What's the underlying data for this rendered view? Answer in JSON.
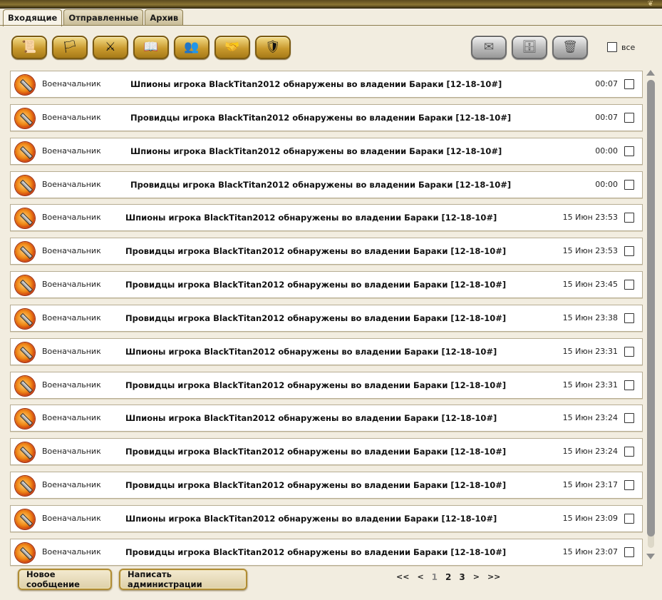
{
  "tabs": [
    {
      "label": "Входящие",
      "active": true
    },
    {
      "label": "Отправленные",
      "active": false
    },
    {
      "label": "Архив",
      "active": false
    }
  ],
  "toolbar": {
    "left_icons": [
      "scroll-letter-icon",
      "flag-icon",
      "sword-shield-icon",
      "book-icon",
      "people-icon",
      "handshake-icon",
      "warrior-icon"
    ],
    "right_icons": [
      "envelope-icon",
      "safe-icon",
      "trash-icon"
    ],
    "select_all_label": "все"
  },
  "messages": [
    {
      "sender": "Военачальник",
      "subject": "Шпионы игрока BlackTitan2012 обнаружены во владении Бараки [12-18-10#]",
      "time": "00:07"
    },
    {
      "sender": "Военачальник",
      "subject": "Провидцы игрока BlackTitan2012 обнаружены во владении Бараки [12-18-10#]",
      "time": "00:07"
    },
    {
      "sender": "Военачальник",
      "subject": "Шпионы игрока BlackTitan2012 обнаружены во владении Бараки [12-18-10#]",
      "time": "00:00"
    },
    {
      "sender": "Военачальник",
      "subject": "Провидцы игрока BlackTitan2012 обнаружены во владении Бараки [12-18-10#]",
      "time": "00:00"
    },
    {
      "sender": "Военачальник",
      "subject": "Шпионы игрока BlackTitan2012 обнаружены во владении Бараки [12-18-10#]",
      "time": "15 Июн 23:53"
    },
    {
      "sender": "Военачальник",
      "subject": "Провидцы игрока BlackTitan2012 обнаружены во владении Бараки [12-18-10#]",
      "time": "15 Июн 23:53"
    },
    {
      "sender": "Военачальник",
      "subject": "Провидцы игрока BlackTitan2012 обнаружены во владении Бараки [12-18-10#]",
      "time": "15 Июн 23:45"
    },
    {
      "sender": "Военачальник",
      "subject": "Провидцы игрока BlackTitan2012 обнаружены во владении Бараки [12-18-10#]",
      "time": "15 Июн 23:38"
    },
    {
      "sender": "Военачальник",
      "subject": "Шпионы игрока BlackTitan2012 обнаружены во владении Бараки [12-18-10#]",
      "time": "15 Июн 23:31"
    },
    {
      "sender": "Военачальник",
      "subject": "Провидцы игрока BlackTitan2012 обнаружены во владении Бараки [12-18-10#]",
      "time": "15 Июн 23:31"
    },
    {
      "sender": "Военачальник",
      "subject": "Шпионы игрока BlackTitan2012 обнаружены во владении Бараки [12-18-10#]",
      "time": "15 Июн 23:24"
    },
    {
      "sender": "Военачальник",
      "subject": "Провидцы игрока BlackTitan2012 обнаружены во владении Бараки [12-18-10#]",
      "time": "15 Июн 23:24"
    },
    {
      "sender": "Военачальник",
      "subject": "Провидцы игрока BlackTitan2012 обнаружены во владении Бараки [12-18-10#]",
      "time": "15 Июн 23:17"
    },
    {
      "sender": "Военачальник",
      "subject": "Шпионы игрока BlackTitan2012 обнаружены во владении Бараки [12-18-10#]",
      "time": "15 Июн 23:09"
    },
    {
      "sender": "Военачальник",
      "subject": "Провидцы игрока BlackTitan2012 обнаружены во владении Бараки [12-18-10#]",
      "time": "15 Июн 23:07"
    }
  ],
  "buttons": {
    "new_message": "Новое сообщение",
    "write_admin": "Написать администрации"
  },
  "pager": {
    "first": "<<",
    "prev": "<",
    "pages": [
      "1",
      "2",
      "3"
    ],
    "current": "1",
    "next": ">",
    "last": ">>"
  },
  "colors": {
    "background": "#f2ede0",
    "gold_button": "#c99a2e",
    "grey_button": "#b9b9b9",
    "row_border": "#b7ad93"
  }
}
